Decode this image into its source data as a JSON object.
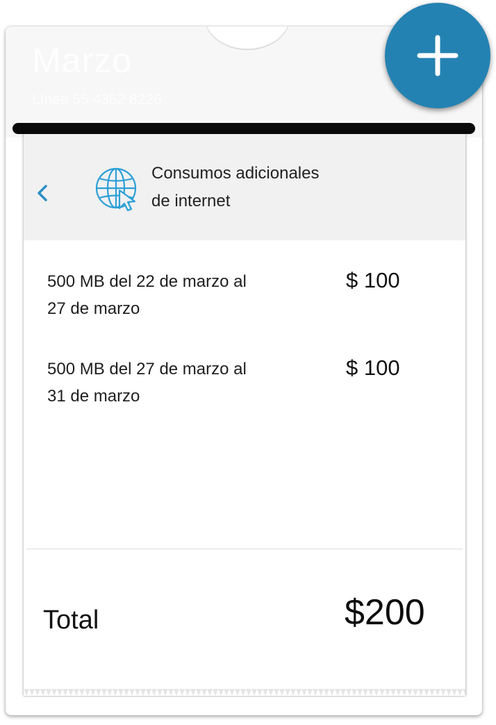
{
  "card": {
    "month": "Marzo",
    "line_label": "Línea 55 4352 8226"
  },
  "detail": {
    "title_line1": "Consumos adicionales",
    "title_line2": "de internet",
    "back_icon": "chevron-left-icon",
    "category_icon": "globe-cursor-icon"
  },
  "items": [
    {
      "description_line1": "500 MB del 22 de marzo al",
      "description_line2": "27 de marzo",
      "price": "$ 100"
    },
    {
      "description_line1": "500 MB del 27 de marzo al",
      "description_line2": "31 de marzo",
      "price": "$ 100"
    }
  ],
  "total": {
    "label": "Total",
    "value": "$200"
  },
  "actions": {
    "add_icon": "plus-icon"
  },
  "colors": {
    "accent": "#2482b2",
    "icon_blue": "#2b9fd6",
    "header_bg": "#f1f1f1",
    "slot": "#0a0a0a"
  }
}
